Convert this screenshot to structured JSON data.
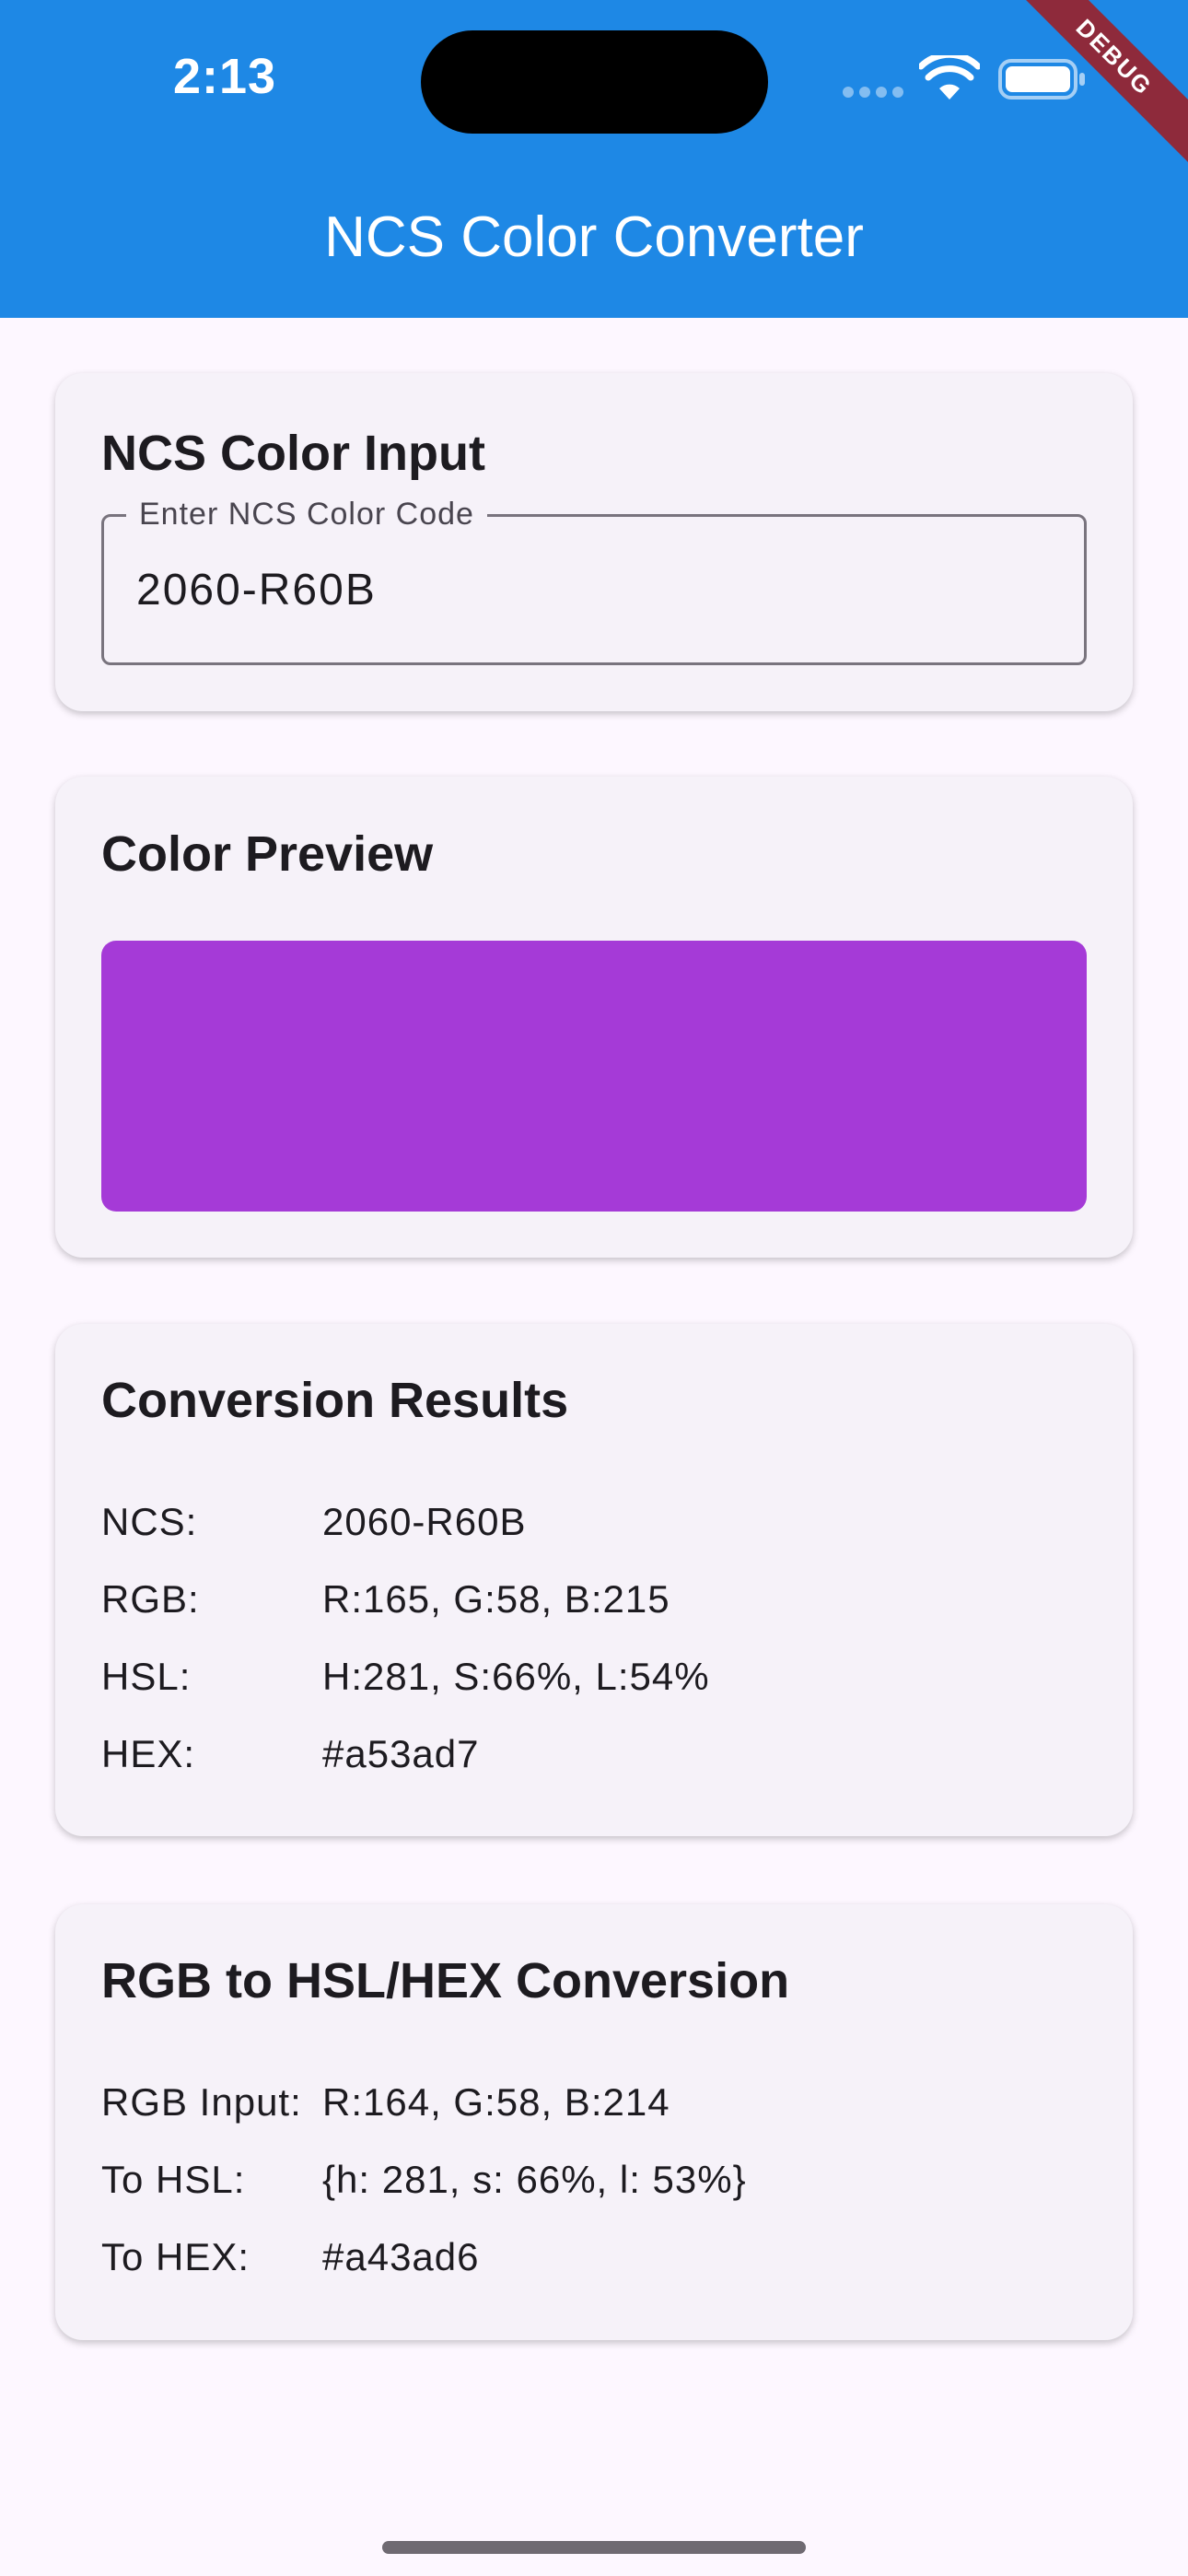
{
  "status_bar": {
    "time": "2:13"
  },
  "debug_banner": "DEBUG",
  "app_bar": {
    "title": "NCS Color Converter"
  },
  "input_card": {
    "title": "NCS Color Input",
    "field_label": "Enter NCS Color Code",
    "field_value": "2060-R60B"
  },
  "preview_card": {
    "title": "Color Preview",
    "color": "#a53ad7"
  },
  "results_card": {
    "title": "Conversion Results",
    "rows": [
      {
        "label": "NCS:",
        "value": "2060-R60B"
      },
      {
        "label": "RGB:",
        "value": "R:165, G:58, B:215"
      },
      {
        "label": "HSL:",
        "value": "H:281, S:66%, L:54%"
      },
      {
        "label": "HEX:",
        "value": "#a53ad7"
      }
    ]
  },
  "rgb_card": {
    "title": "RGB to HSL/HEX Conversion",
    "rows": [
      {
        "label": "RGB Input:",
        "value": "R:164, G:58, B:214"
      },
      {
        "label": "To HSL:",
        "value": "{h: 281, s: 66%, l: 53%}"
      },
      {
        "label": "To HEX:",
        "value": "#a43ad6"
      }
    ]
  },
  "colors": {
    "app_bar": "#1e88e5",
    "background": "#fdf7ff",
    "card": "#f6f2f9",
    "debug_ribbon": "#8e2a3b"
  }
}
